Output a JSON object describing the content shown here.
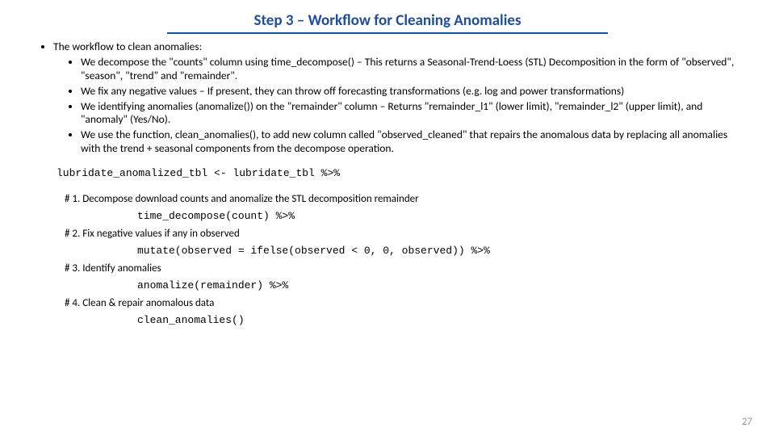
{
  "title": "Step 3 – Workflow for Cleaning Anomalies",
  "bullets": {
    "main": "The workflow to clean anomalies:",
    "sub": [
      "We decompose the \"counts\" column using time_decompose() – This returns a Seasonal-Trend-Loess (STL) Decomposition in the form of \"observed\", \"season\", \"trend\" and \"remainder\".",
      "We fix any negative values – If present, they can throw off forecasting transformations (e.g. log and power transformations)",
      "We identifying anomalies (anomalize()) on the \"remainder\" column – Returns \"remainder_l1\" (lower limit), \"remainder_l2\" (upper limit), and \"anomaly\" (Yes/No).",
      "We use the function, clean_anomalies(), to add new column called \"observed_cleaned\" that repairs the anomalous data by replacing all anomalies with the trend + seasonal components from the decompose operation."
    ]
  },
  "code_intro": "lubridate_anomalized_tbl <- lubridate_tbl %>%",
  "steps": [
    {
      "label": "# 1. Decompose download counts and anomalize the STL decomposition remainder",
      "code": "time_decompose(count) %>%"
    },
    {
      "label": "# 2. Fix negative values if any in observed",
      "code": "mutate(observed = ifelse(observed < 0, 0, observed)) %>%"
    },
    {
      "label": "# 3. Identify anomalies",
      "code": "anomalize(remainder) %>%"
    },
    {
      "label": "# 4. Clean & repair anomalous data",
      "code": "clean_anomalies()"
    }
  ],
  "page_number": "27"
}
